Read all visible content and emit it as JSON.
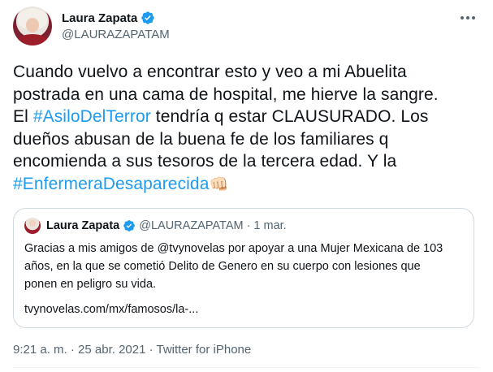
{
  "author": {
    "display_name": "Laura Zapata",
    "handle": "@LAURAZAPATAM",
    "verified": true
  },
  "tweet": {
    "lines": [
      [
        {
          "text": "Cuando vuelvo a encontrar esto y veo a mi Abuelita"
        }
      ],
      [
        {
          "text": "postrada en una cama de hospital, me hierve la sangre."
        }
      ],
      [
        {
          "text": "El "
        },
        {
          "text": "#AsiloDelTerror",
          "hashtag": true
        },
        {
          "text": " tendría q estar CLAUSURADO. Los"
        }
      ],
      [
        {
          "text": "dueños abusan de la buena fe de los familiares q"
        }
      ],
      [
        {
          "text": "encomienda a sus tesoros de la tercera edad. Y la"
        }
      ],
      [
        {
          "text": "#EnfermeraDesaparecida",
          "hashtag": true
        },
        {
          "text": "👊🏻",
          "emoji": true
        }
      ]
    ]
  },
  "quoted_tweet": {
    "display_name": "Laura Zapata",
    "handle": "@LAURAZAPATAM",
    "separator": "·",
    "date": "1 mar.",
    "lines": [
      "Gracias a mis amigos de @tvynovelas por apoyar a una Mujer Mexicana de 103",
      "años, en la que se cometió Delito de Genero en su cuerpo con lesiones que",
      "ponen en peligro su vida."
    ],
    "link": "tvynovelas.com/mx/famosos/la-..."
  },
  "meta": {
    "text": "9:21 a. m. · 25 abr. 2021 · Twitter for iPhone"
  },
  "icons": {
    "verified": "verified-badge-icon",
    "more": "more-options-icon"
  },
  "colors": {
    "accent": "#1d9bf0",
    "secondary_text": "#536471",
    "border": "#cfd9de"
  }
}
